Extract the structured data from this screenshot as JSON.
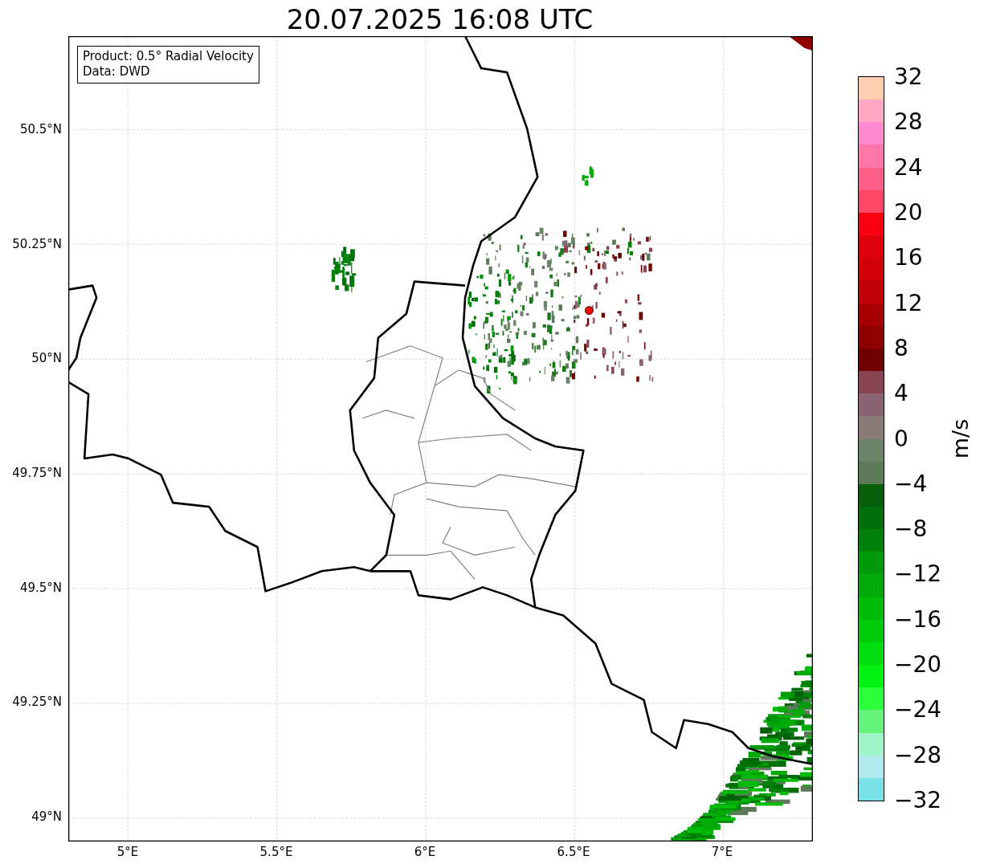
{
  "title": "20.07.2025 16:08 UTC",
  "info_box": {
    "lines": [
      "Product: 0.5° Radial Velocity",
      "Data: DWD"
    ]
  },
  "map": {
    "lat_labels": [
      "50.5°N",
      "50.25°N",
      "50°N",
      "49.75°N",
      "49.5°N",
      "49.25°N",
      "49°N"
    ],
    "lon_labels": [
      "5°E",
      "5.5°E",
      "6°E",
      "6.5°E",
      "7°E"
    ]
  },
  "colorbar": {
    "label": "m/s",
    "ticks": [
      "32",
      "28",
      "24",
      "20",
      "16",
      "12",
      "8",
      "4",
      "0",
      "−4",
      "−8",
      "−12",
      "−16",
      "−20",
      "−24",
      "−28",
      "−32"
    ],
    "segments": [
      {
        "color": "#ffcdb0"
      },
      {
        "color": "#ffa8c4"
      },
      {
        "color": "#ff88d0"
      },
      {
        "color": "#ff77a8"
      },
      {
        "color": "#ff5e88"
      },
      {
        "color": "#ff4664"
      },
      {
        "color": "#f80010"
      },
      {
        "color": "#e0000c"
      },
      {
        "color": "#d40008"
      },
      {
        "color": "#c00006"
      },
      {
        "color": "#a80000"
      },
      {
        "color": "#900000"
      },
      {
        "color": "#700000"
      },
      {
        "color": "#884450"
      },
      {
        "color": "#8a6472"
      },
      {
        "color": "#8a7a78"
      },
      {
        "color": "#6a8468"
      },
      {
        "color": "#5c7a58"
      },
      {
        "color": "#06600a"
      },
      {
        "color": "#02700a"
      },
      {
        "color": "#00820a"
      },
      {
        "color": "#009a0a"
      },
      {
        "color": "#00aa08"
      },
      {
        "color": "#00bc08"
      },
      {
        "color": "#00cc0a"
      },
      {
        "color": "#00dc0e"
      },
      {
        "color": "#00f210"
      },
      {
        "color": "#2cff3c"
      },
      {
        "color": "#66f57a"
      },
      {
        "color": "#a0f5c8"
      },
      {
        "color": "#b0eaee"
      },
      {
        "color": "#78e2e8"
      }
    ]
  }
}
